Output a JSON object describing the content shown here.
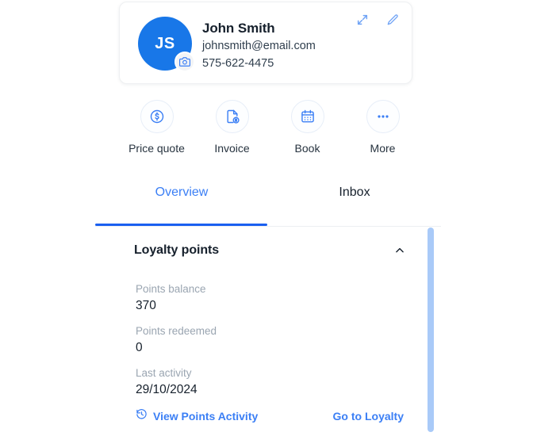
{
  "contact": {
    "initials": "JS",
    "name": "John Smith",
    "email": "johnsmith@email.com",
    "phone": "575-622-4475",
    "camera_icon": "camera-icon",
    "expand_icon": "expand-icon",
    "edit_icon": "pencil-edit-icon"
  },
  "actions": [
    {
      "label": "Price quote",
      "icon": "dollar-circle-icon"
    },
    {
      "label": "Invoice",
      "icon": "invoice-document-dollar-icon"
    },
    {
      "label": "Book",
      "icon": "calendar-icon"
    },
    {
      "label": "More",
      "icon": "ellipsis-icon"
    }
  ],
  "tabs": [
    {
      "label": "Overview",
      "active": true
    },
    {
      "label": "Inbox",
      "active": false
    }
  ],
  "loyalty": {
    "title": "Loyalty points",
    "collapse_icon": "chevron-up-icon",
    "stats": [
      {
        "label": "Points balance",
        "value": "370"
      },
      {
        "label": "Points redeemed",
        "value": "0"
      },
      {
        "label": "Last activity",
        "value": "29/10/2024"
      }
    ],
    "view_activity_label": "View Points Activity",
    "view_activity_icon": "history-clock-icon",
    "go_to_loyalty_label": "Go to Loyalty"
  },
  "colors": {
    "accent_blue": "#3b7ff5",
    "avatar_blue": "#1877e8",
    "tab_indicator": "#1a5ff0",
    "scrollbar_thumb": "#a9caf8",
    "muted_text": "#9aa5b1"
  }
}
